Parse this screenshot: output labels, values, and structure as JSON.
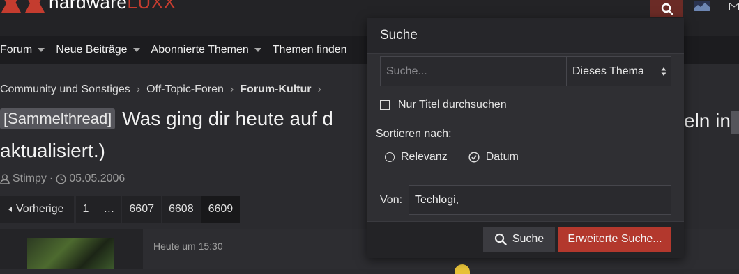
{
  "brand": {
    "name_main": "hardware",
    "name_accent": "LUXX",
    "accent_color": "#c43c2f"
  },
  "header": {
    "search_icon": "search-icon",
    "mail_icon": "mail-icon"
  },
  "nav": {
    "items": [
      {
        "label": "Forum",
        "dropdown": true
      },
      {
        "label": "Neue Beiträge",
        "dropdown": true
      },
      {
        "label": "Abonnierte Themen",
        "dropdown": true
      },
      {
        "label": "Themen finden",
        "dropdown": false
      }
    ]
  },
  "breadcrumb": {
    "items": [
      "Community und Sonstiges",
      "Off-Topic-Foren",
      "Forum-Kultur"
    ],
    "separator": "›"
  },
  "thread": {
    "prefix": "[Sammelthread]",
    "title_line1": "Was ging dir heute auf d",
    "title_line1_right": "eln in",
    "title_line2": "aktualisiert.)",
    "author": "Stimpy",
    "date": "05.05.2006"
  },
  "pagination": {
    "prev_label": "Vorherige",
    "pages": [
      "1",
      "…",
      "6607",
      "6608",
      "6609"
    ],
    "current": "6609"
  },
  "post": {
    "time": "Heute um 15:30"
  },
  "search_popup": {
    "title": "Suche",
    "query_placeholder": "Suche...",
    "scope_value": "Dieses Thema",
    "titles_only_label": "Nur Titel durchsuchen",
    "titles_only_checked": false,
    "sort_label": "Sortieren nach:",
    "sort_options": [
      "Relevanz",
      "Datum"
    ],
    "sort_selected": "Datum",
    "from_label": "Von:",
    "from_value": "Techlogi,",
    "search_button": "Suche",
    "advanced_button": "Erweiterte Suche...",
    "colors": {
      "panel": "#2f2f33",
      "primary_button": "#b3382d"
    }
  }
}
